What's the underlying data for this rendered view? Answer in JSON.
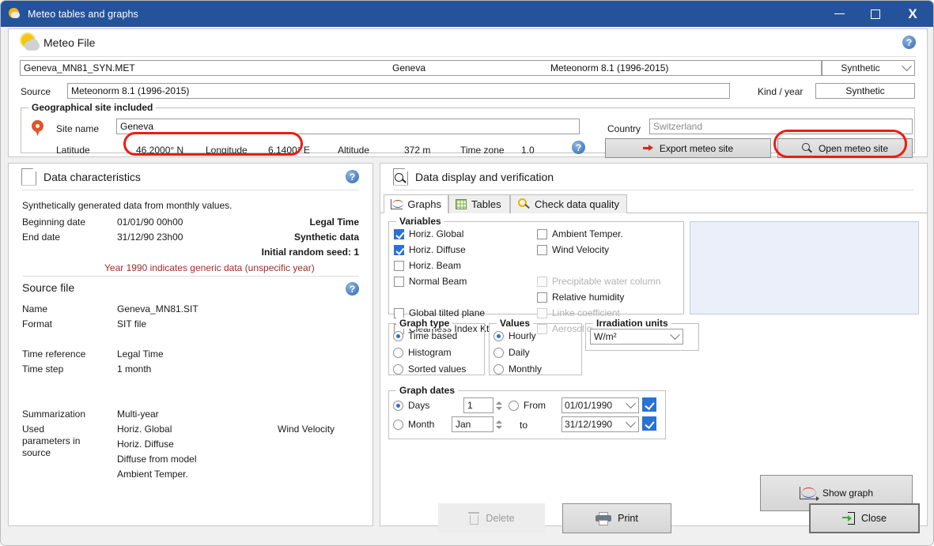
{
  "window": {
    "title": "Meteo tables and graphs",
    "minimize": "–",
    "maximize": "□",
    "close": "X"
  },
  "meteo_file": {
    "header_title": "Meteo File",
    "help": "?",
    "file_name": "Geneva_MN81_SYN.MET",
    "file_site": "Geneva",
    "file_source_label": "Meteonorm 8.1 (1996-2015)",
    "file_kind_combo": "Synthetic",
    "source_label": "Source",
    "source_value": "Meteonorm 8.1 (1996-2015)",
    "kind_year_label": "Kind / year",
    "kind_year_value": "Synthetic",
    "geo_group_title": "Geographical site included",
    "site_name_label": "Site name",
    "site_name_value": "Geneva",
    "latitude_label": "Latitude",
    "latitude_value": "46.2000° N",
    "longitude_label": "Longitude",
    "longitude_value": "6.1400° E",
    "altitude_label": "Altitude",
    "altitude_value": "372 m",
    "timezone_label": "Time zone",
    "timezone_value": "1.0",
    "country_label": "Country",
    "country_value": "Switzerland",
    "export_button": "Export meteo site",
    "open_button": "Open meteo site"
  },
  "data_characteristics": {
    "header_title": "Data characteristics",
    "help": "?",
    "intro": "Synthetically generated data from monthly values.",
    "beginning_date_label": "Beginning date",
    "beginning_date_value": "01/01/90 00h00",
    "end_date_label": "End date",
    "end_date_value": "31/12/90 23h00",
    "legal_time": "Legal Time",
    "synthetic_data": "Synthetic data",
    "initial_seed": "Initial random seed: 1",
    "note": "Year 1990 indicates generic data (unspecific year)",
    "source_file_title": "Source file",
    "source_help": "?",
    "name_label": "Name",
    "name_value": "Geneva_MN81.SIT",
    "format_label": "Format",
    "format_value": "SIT file",
    "time_reference_label": "Time reference",
    "time_reference_value": "Legal Time",
    "time_step_label": "Time step",
    "time_step_value": "1 month",
    "summarization_label": "Summarization",
    "summarization_value": "Multi-year",
    "used_params_label_l1": "Used",
    "used_params_label_l2": "parameters in",
    "used_params_label_l3": "source",
    "used_params": [
      "Horiz. Global",
      "Horiz. Diffuse",
      "Diffuse from model",
      "Ambient Temper."
    ],
    "used_params_right": "Wind Velocity"
  },
  "data_display": {
    "header_title": "Data display and verification",
    "tabs": [
      {
        "label": "Graphs",
        "icon": "graph-icon",
        "active": true
      },
      {
        "label": "Tables",
        "icon": "table-icon",
        "active": false
      },
      {
        "label": "Check data quality",
        "icon": "check-quality-icon",
        "active": false
      }
    ],
    "variables_group": "Variables",
    "variables_left": [
      {
        "label": "Horiz. Global",
        "checked": true,
        "disabled": false
      },
      {
        "label": "Horiz. Diffuse",
        "checked": true,
        "disabled": false
      },
      {
        "label": "Horiz. Beam",
        "checked": false,
        "disabled": false
      },
      {
        "label": "Normal Beam",
        "checked": false,
        "disabled": false
      },
      {
        "label": "Global tilted plane",
        "checked": false,
        "disabled": false
      },
      {
        "label": "Clearness Index Kt",
        "checked": false,
        "disabled": false
      }
    ],
    "variables_right": [
      {
        "label": "Ambient Temper.",
        "checked": false,
        "disabled": false
      },
      {
        "label": "Wind Velocity",
        "checked": false,
        "disabled": false
      },
      {
        "label": "Precipitable water column",
        "checked": false,
        "disabled": true
      },
      {
        "label": "Relative humidity",
        "checked": false,
        "disabled": false
      },
      {
        "label": "Linke coefficient",
        "checked": false,
        "disabled": true
      },
      {
        "label": "Aerosol optical depth",
        "checked": false,
        "disabled": true
      }
    ],
    "graph_type_group": "Graph type",
    "graph_type_options": [
      {
        "label": "Time based",
        "selected": true
      },
      {
        "label": "Histogram",
        "selected": false
      },
      {
        "label": "Sorted values",
        "selected": false
      }
    ],
    "values_group": "Values",
    "values_options": [
      {
        "label": "Hourly",
        "selected": true
      },
      {
        "label": "Daily",
        "selected": false
      },
      {
        "label": "Monthly",
        "selected": false
      }
    ],
    "irradiation_group": "Irradiation units",
    "irradiation_value": "W/m²",
    "graph_dates_group": "Graph dates",
    "days_label": "Days",
    "days_value": "1",
    "month_label": "Month",
    "month_value": "Jan",
    "from_label": "From",
    "from_value": "01/01/1990",
    "to_label": "to",
    "to_value": "31/12/1990",
    "show_graph_button": "Show graph"
  },
  "footer": {
    "delete": "Delete",
    "print": "Print",
    "close": "Close"
  }
}
